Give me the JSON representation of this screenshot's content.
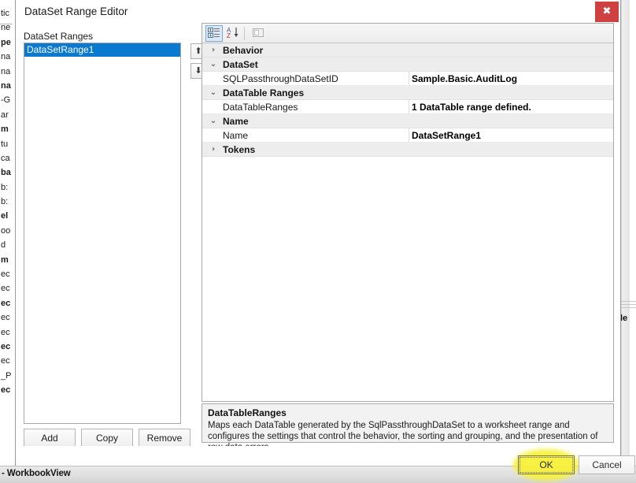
{
  "background": {
    "left_fragments": [
      "tic",
      "ne",
      "pe",
      "na",
      "na",
      "na",
      "-G",
      "ar",
      "m",
      "tu",
      "ca",
      "ba",
      "b:",
      "b:",
      "el",
      "oo",
      "d",
      "m",
      "ec",
      "ec",
      "ec",
      "ec",
      "ec",
      "ec",
      "ec",
      "_P",
      "ec"
    ],
    "right_fragment": "le"
  },
  "status_bar": {
    "text": "- WorkbookView"
  },
  "dialog": {
    "title": "DataSet Range Editor",
    "close_icon": "close-icon",
    "close_glyph": "✖",
    "left_pane": {
      "label": "DataSet Ranges",
      "items": [
        {
          "label": "DataSetRange1",
          "selected": true
        }
      ],
      "move_up_glyph": "⬆",
      "move_down_glyph": "⬇",
      "buttons": {
        "add": "Add",
        "copy": "Copy",
        "remove": "Remove"
      }
    },
    "property_grid": {
      "toolbar": {
        "categorized_tooltip": "Categorized",
        "alphabetic_tooltip": "Alphabetical",
        "property_pages_tooltip": "Property Pages"
      },
      "rows": [
        {
          "type": "category",
          "name": "Behavior",
          "expander": "›",
          "expanded": false,
          "value": ""
        },
        {
          "type": "category",
          "name": "DataSet",
          "expander": "⌄",
          "expanded": true,
          "value": ""
        },
        {
          "type": "property",
          "name": "SQLPassthroughDataSetID",
          "expander": "",
          "value": "Sample.Basic.AuditLog"
        },
        {
          "type": "category",
          "name": "DataTable Ranges",
          "expander": "⌄",
          "expanded": true,
          "value": ""
        },
        {
          "type": "property",
          "name": "DataTableRanges",
          "expander": "",
          "value": "1 DataTable range defined."
        },
        {
          "type": "category",
          "name": "Name",
          "expander": "⌄",
          "expanded": true,
          "value": ""
        },
        {
          "type": "property",
          "name": "Name",
          "expander": "",
          "value": "DataSetRange1"
        },
        {
          "type": "category",
          "name": "Tokens",
          "expander": "›",
          "expanded": false,
          "value": ""
        }
      ]
    },
    "description": {
      "title": "DataTableRanges",
      "body": "Maps each DataTable generated by the SqlPassthroughDataSet to a worksheet range and configures the settings that control the behavior, the sorting and grouping, and the presentation of row data errors."
    },
    "footer": {
      "ok": "OK",
      "cancel": "Cancel"
    }
  },
  "colors": {
    "selection_blue": "#0a7ad1",
    "close_red": "#cf4040",
    "highlight_yellow": "#f7f13f",
    "category_row": "#ededed"
  }
}
